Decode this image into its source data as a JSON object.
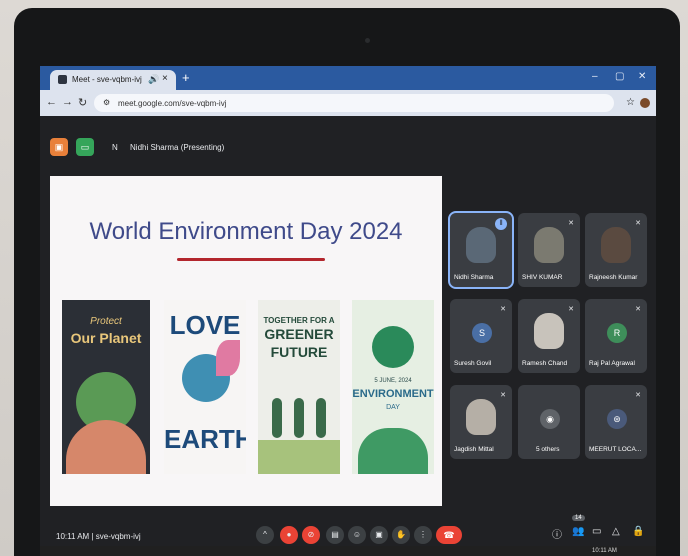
{
  "browser": {
    "tab_title": "Meet - sve-vqbm-ivj",
    "url": "meet.google.com/sve-vqbm-ivj",
    "window_controls": [
      "–",
      "▢",
      "✕"
    ]
  },
  "meet": {
    "presenter_initial": "N",
    "presenter_text": "Nidhi Sharma (Presenting)",
    "slide": {
      "title": "World Environment Day 2024",
      "posters": [
        {
          "line1": "Protect",
          "line2": "Our Planet"
        },
        {
          "line1": "LOVE",
          "line2": "EARTH"
        },
        {
          "line1": "TOGETHER FOR A",
          "line2": "GREENER",
          "line3": "FUTURE"
        },
        {
          "line1": "5 JUNE, 2024",
          "line2": "ENVIRONMENT",
          "line3": "DAY"
        }
      ]
    },
    "participants": [
      {
        "name": "Nidhi Sharma",
        "color": "#3b4a5a"
      },
      {
        "name": "SHIV KUMAR",
        "color": "#4a4f48"
      },
      {
        "name": "Rajneesh Kumar",
        "color": "#3f3a36"
      },
      {
        "name": "Suresh Govil",
        "initial": "S",
        "color": "#4a6fa5"
      },
      {
        "name": "Ramesh Chand",
        "color": "#6b6660"
      },
      {
        "name": "Raj Pal Agrawal",
        "initial": "R",
        "color": "#3e8e5a"
      },
      {
        "name": "Jagdish Mittal",
        "color": "#8a8580"
      },
      {
        "name": "5 others",
        "color": "#3a3d42"
      },
      {
        "name": "MEERUT LOCA...",
        "color": "#3a3d42"
      }
    ],
    "bottom_bar": {
      "time": "10:11 AM",
      "separator": "|",
      "meeting_code": "sve-vqbm-ivj",
      "participant_count": "14"
    },
    "taskbar_time": "10:11 AM"
  },
  "colors": {
    "accent_blue": "#8ab4f8",
    "end_call": "#ea4335",
    "slide_title": "#3f4a8a"
  }
}
